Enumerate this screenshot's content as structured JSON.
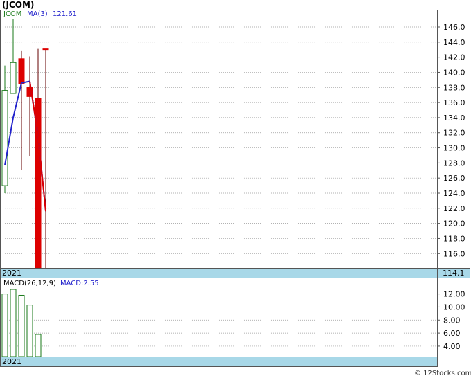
{
  "title": "(JCOM)",
  "copyright": "© 12Stocks.com",
  "colors": {
    "up": "#1a7a1a",
    "down": "#dd0000",
    "ma": "#2222cc",
    "macd_bar": "#1a7a1a",
    "year_band": "#a8d8e8",
    "grid": "#999999"
  },
  "chart_data": [
    {
      "type": "candlestick",
      "legend": {
        "ticker": "JCOM",
        "ma_label": "MA(3)",
        "ma_value": "121.61"
      },
      "year_label": "2021",
      "last_price_label": "114.1",
      "ylim": [
        114.1,
        148.2
      ],
      "yticks": [
        "116.0",
        "118.0",
        "120.0",
        "122.0",
        "124.0",
        "126.0",
        "128.0",
        "130.0",
        "132.0",
        "134.0",
        "136.0",
        "138.0",
        "140.0",
        "142.0",
        "144.0",
        "146.0"
      ],
      "grid": true,
      "candles": [
        {
          "open": 125.0,
          "high": 140.9,
          "low": 124.0,
          "close": 137.6,
          "dir": "up"
        },
        {
          "open": 137.2,
          "high": 147.1,
          "low": 137.2,
          "close": 141.3,
          "dir": "up"
        },
        {
          "open": 141.8,
          "high": 142.9,
          "low": 127.1,
          "close": 138.5,
          "dir": "down"
        },
        {
          "open": 138.0,
          "high": 142.1,
          "low": 128.9,
          "close": 136.8,
          "dir": "down"
        },
        {
          "open": 136.6,
          "high": 143.1,
          "low": 114.1,
          "close": 114.1,
          "dir": "down"
        },
        {
          "open": 143.1,
          "high": 143.1,
          "low": 114.1,
          "close": 143.1,
          "dir": "down"
        }
      ],
      "ma": [
        127.7,
        134.0,
        138.6,
        138.8,
        131.6,
        121.6
      ]
    },
    {
      "type": "bar",
      "legend": {
        "label": "MACD(26,12,9)",
        "value_label": "MACD:2.55"
      },
      "year_label": "2021",
      "ylim": [
        2.4,
        14.4
      ],
      "yticks": [
        "4.00",
        "6.00",
        "8.00",
        "10.00",
        "12.00"
      ],
      "grid": true,
      "values": [
        12.0,
        12.7,
        11.8,
        10.3,
        5.8
      ]
    }
  ]
}
